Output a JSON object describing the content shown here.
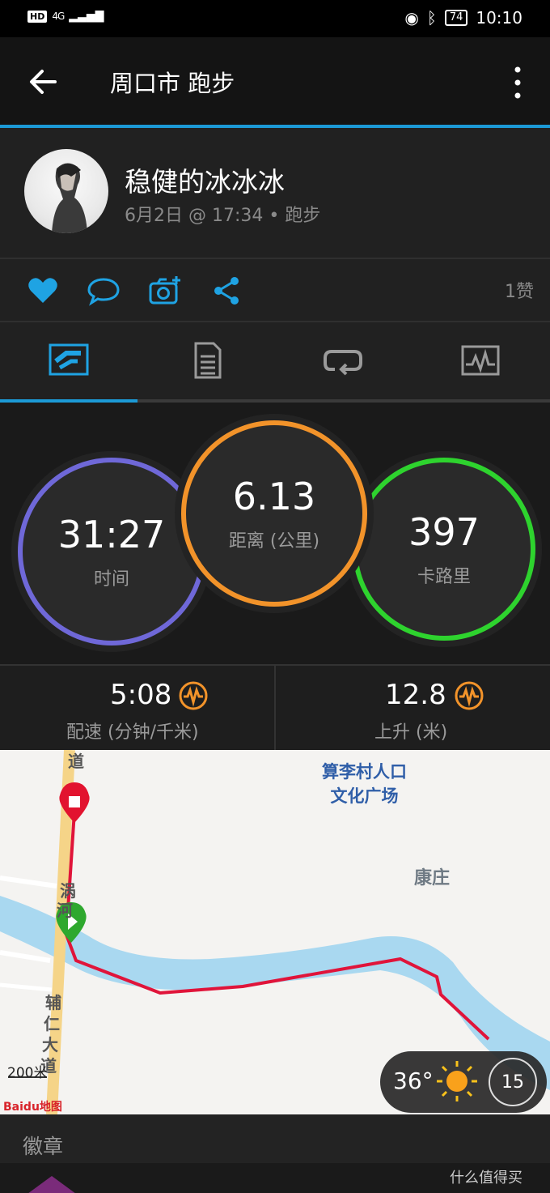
{
  "status": {
    "network": "4G",
    "battery": "74",
    "time": "10:10"
  },
  "toolbar": {
    "title": "周口市 跑步"
  },
  "profile": {
    "username": "稳健的冰冰冰",
    "meta": "6月2日 @ 17:34 • 跑步"
  },
  "actions": {
    "likes": "1赞"
  },
  "stats": {
    "time": {
      "value": "31:27",
      "label": "时间",
      "color": "#7b6fd6"
    },
    "distance": {
      "value": "6.13",
      "label": "距离 (公里)",
      "color": "#f28c28"
    },
    "calories": {
      "value": "397",
      "label": "卡路里",
      "color": "#2ed32e"
    }
  },
  "substats": {
    "pace": {
      "value": "5:08",
      "label": "配速 (分钟/千米)"
    },
    "ascent": {
      "value": "12.8",
      "label": "上升 (米)"
    }
  },
  "map": {
    "poi_square": "算李村人口\n文化广场",
    "poi_square_line1": "算李村人口",
    "poi_square_line2": "文化广场",
    "poi_village": "康庄",
    "road_top": "道",
    "road_mid1": "涡",
    "road_mid2": "河",
    "road_fu": "辅",
    "road_ren": "仁",
    "road_da": "大",
    "road_dao": "道",
    "scale": "200米",
    "logo": "Baidu地图",
    "temperature": "36°",
    "wind": "15"
  },
  "badges": {
    "label": "徽章"
  },
  "watermark": "什么值得买"
}
